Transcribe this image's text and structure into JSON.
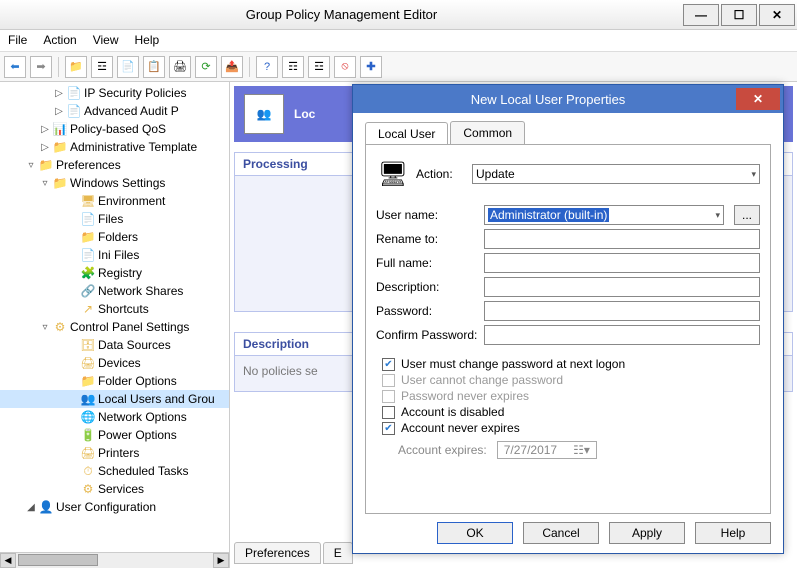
{
  "window": {
    "title": "Group Policy Management Editor"
  },
  "menu": {
    "file": "File",
    "action": "Action",
    "view": "View",
    "help": "Help"
  },
  "tree": {
    "items": [
      {
        "label": "IP Security Policies",
        "exp": "▷",
        "ico": "📄",
        "cls": "indent1"
      },
      {
        "label": "Advanced Audit P",
        "exp": "▷",
        "ico": "📄",
        "cls": "indent1"
      },
      {
        "label": "Policy-based QoS",
        "exp": "▷",
        "ico": "📊",
        "cls": "indent0"
      },
      {
        "label": "Administrative Template",
        "exp": "▷",
        "ico": "📁",
        "cls": "indent0"
      },
      {
        "label": "Preferences",
        "exp": "▿",
        "ico": "📁",
        "cls": "indentA"
      },
      {
        "label": "Windows Settings",
        "exp": "▿",
        "ico": "📁",
        "cls": "indent0"
      },
      {
        "label": "Environment",
        "exp": "",
        "ico": "🖥",
        "cls": "indent2"
      },
      {
        "label": "Files",
        "exp": "",
        "ico": "📄",
        "cls": "indent2"
      },
      {
        "label": "Folders",
        "exp": "",
        "ico": "📁",
        "cls": "indent2"
      },
      {
        "label": "Ini Files",
        "exp": "",
        "ico": "📄",
        "cls": "indent2"
      },
      {
        "label": "Registry",
        "exp": "",
        "ico": "🧩",
        "cls": "indent2"
      },
      {
        "label": "Network Shares",
        "exp": "",
        "ico": "🔗",
        "cls": "indent2"
      },
      {
        "label": "Shortcuts",
        "exp": "",
        "ico": "↗",
        "cls": "indent2"
      },
      {
        "label": "Control Panel Settings",
        "exp": "▿",
        "ico": "⚙",
        "cls": "indent0"
      },
      {
        "label": "Data Sources",
        "exp": "",
        "ico": "🗄",
        "cls": "indent2"
      },
      {
        "label": "Devices",
        "exp": "",
        "ico": "🖨",
        "cls": "indent2"
      },
      {
        "label": "Folder Options",
        "exp": "",
        "ico": "📁",
        "cls": "indent2"
      },
      {
        "label": "Local Users and Grou",
        "exp": "",
        "ico": "👥",
        "cls": "indent2",
        "sel": true
      },
      {
        "label": "Network Options",
        "exp": "",
        "ico": "🌐",
        "cls": "indent2"
      },
      {
        "label": "Power Options",
        "exp": "",
        "ico": "🔋",
        "cls": "indent2"
      },
      {
        "label": "Printers",
        "exp": "",
        "ico": "🖨",
        "cls": "indent2"
      },
      {
        "label": "Scheduled Tasks",
        "exp": "",
        "ico": "⏱",
        "cls": "indent2"
      },
      {
        "label": "Services",
        "exp": "",
        "ico": "⚙",
        "cls": "indent2"
      },
      {
        "label": "User Configuration",
        "exp": "◢",
        "ico": "👤",
        "cls": "indentA"
      }
    ]
  },
  "content": {
    "banner_label": "Loc",
    "processing": "Processing",
    "description": "Description",
    "no_policies": "No policies se",
    "tab_pref": "Preferences",
    "tab_e": "E"
  },
  "dialog": {
    "title": "New Local User Properties",
    "tab_local": "Local User",
    "tab_common": "Common",
    "action_lbl": "Action:",
    "action_val": "Update",
    "username_lbl": "User name:",
    "username_val": "Administrator (built-in)",
    "rename_lbl": "Rename to:",
    "fullname_lbl": "Full name:",
    "desc_lbl": "Description:",
    "pwd_lbl": "Password:",
    "cpwd_lbl": "Confirm Password:",
    "chk_mustchange": "User must change password at next logon",
    "chk_cannot": "User cannot change password",
    "chk_never": "Password never expires",
    "chk_disabled": "Account is disabled",
    "chk_acct_never": "Account never expires",
    "expires_lbl": "Account expires:",
    "expires_val": "7/27/2017",
    "btn_ok": "OK",
    "btn_cancel": "Cancel",
    "btn_apply": "Apply",
    "btn_help": "Help"
  }
}
